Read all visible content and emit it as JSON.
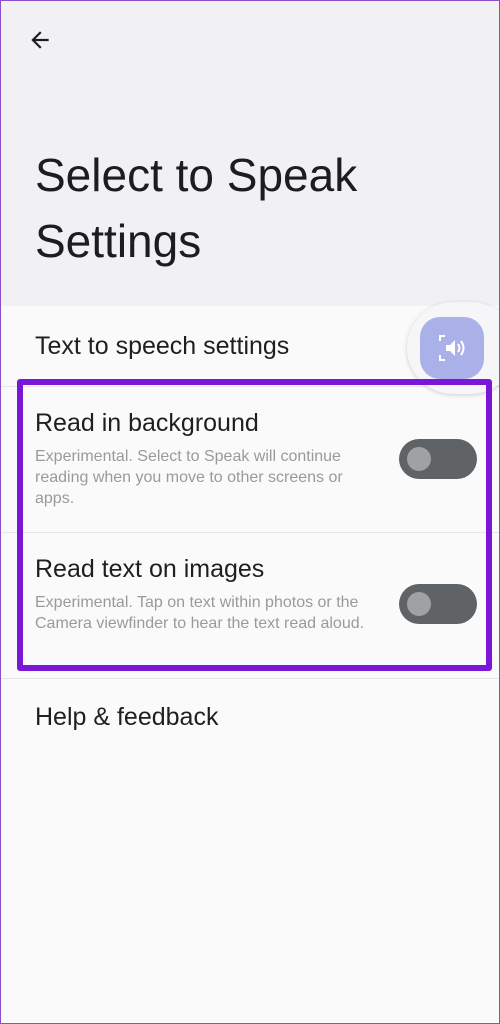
{
  "header": {
    "back_icon": "arrow-left-icon",
    "title": "Select to Speak Settings"
  },
  "items": {
    "tts": {
      "title": "Text to speech settings"
    },
    "read_background": {
      "title": "Read in background",
      "description": "Experimental. Select to Speak will continue reading when you move to other screens or apps.",
      "enabled": false
    },
    "read_images": {
      "title": "Read text on images",
      "description": "Experimental. Tap on text within photos or the Camera viewfinder to hear the text read aloud.",
      "enabled": false
    },
    "help": {
      "title": "Help & feedback"
    }
  },
  "floating_button": {
    "icon": "speaker-select-icon"
  },
  "colors": {
    "highlight": "#7a17d6",
    "toggle_off_track": "#5f6365",
    "toggle_off_thumb": "#9ea2a5",
    "fab_background": "#aab0e8"
  }
}
